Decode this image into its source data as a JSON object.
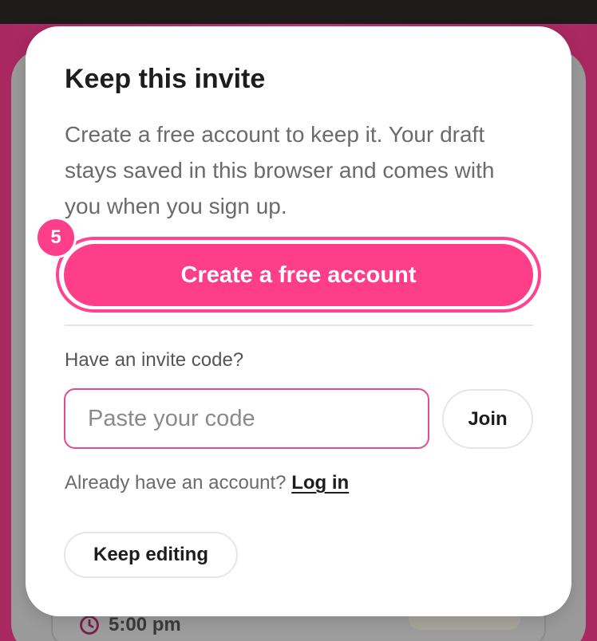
{
  "modal": {
    "title": "Keep this invite",
    "description": "Create a free account to keep it. Your draft stays saved in this browser and comes with you when you sign up.",
    "cta_label": "Create a free account",
    "step_badge": "5",
    "invite_label": "Have an invite code?",
    "code_placeholder": "Paste your code",
    "join_label": "Join",
    "login_prompt": "Already have an account?",
    "login_link": "Log in",
    "keep_editing_label": "Keep editing"
  },
  "background": {
    "event_time": "5:00 pm"
  },
  "colors": {
    "accent": "#ff3e8a",
    "backdrop": "#b52e6c",
    "input_border": "#e44c8d"
  },
  "icons": {
    "time": "clock-icon"
  }
}
